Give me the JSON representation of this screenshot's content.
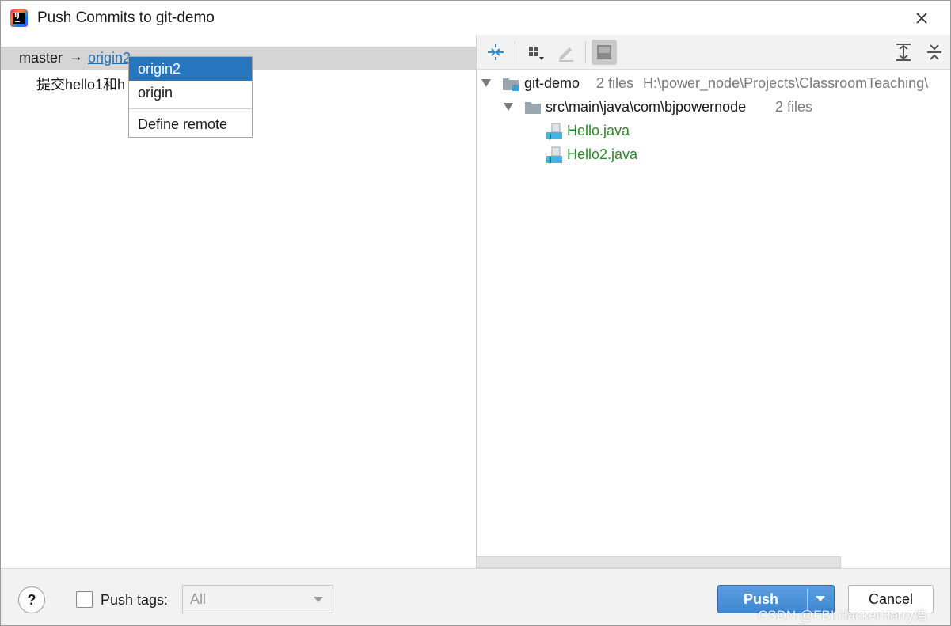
{
  "window": {
    "title": "Push Commits to git-demo"
  },
  "left": {
    "branch": "master",
    "arrow": "→",
    "remote_link": "origin2",
    "commit_message": "提交hello1和h"
  },
  "popup": {
    "items": [
      "origin2",
      "origin"
    ],
    "define_remote": "Define remote",
    "selected": "origin2"
  },
  "tree": {
    "root": {
      "name": "git-demo",
      "files": "2 files",
      "path": "H:\\power_node\\Projects\\ClassroomTeaching\\"
    },
    "package": {
      "name": "src\\main\\java\\com\\bjpowernode",
      "files": "2 files"
    },
    "files": [
      "Hello.java",
      "Hello2.java"
    ]
  },
  "footer": {
    "help": "?",
    "push_tags_label": "Push tags:",
    "tags_value": "All",
    "push_label": "Push",
    "cancel_label": "Cancel",
    "watermark": "CSDN @FBI HackerHarry浩"
  },
  "colors": {
    "selection": "#2675bf",
    "link": "#2470b3",
    "new_file": "#2a8a2a",
    "push_button": "#4a90d9"
  },
  "icons": [
    "app-icon",
    "close-icon",
    "expand-all-icon",
    "group-by-icon",
    "edit-source-icon",
    "preview-icon",
    "expand-tree-icon",
    "collapse-tree-icon",
    "folder-icon",
    "java-file-icon"
  ]
}
